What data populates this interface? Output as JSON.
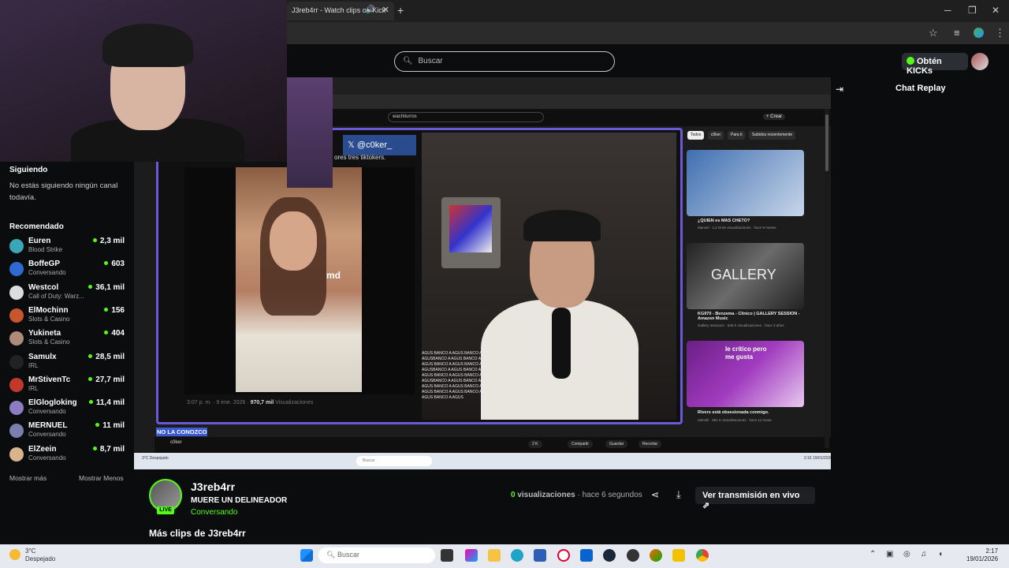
{
  "browser": {
    "tab_title": "J3reb4rr - Watch clips on Kick",
    "tab_close": "✕",
    "new_tab": "+",
    "minimize": "─",
    "restore": "❐",
    "close": "✕"
  },
  "header": {
    "search_placeholder": "Buscar",
    "kicks_label": "Obtén KICKs"
  },
  "sidebar": {
    "following_title": "Siguiendo",
    "following_empty": "No estás siguiendo ningún canal todavía.",
    "recommended_title": "Recomendado",
    "channels": [
      {
        "name": "Euren",
        "category": "Blood Strike",
        "viewers": "2,3 mil",
        "color": "#3aa7b8"
      },
      {
        "name": "BoffeGP",
        "category": "Conversando",
        "viewers": "603",
        "color": "#2e6ad1"
      },
      {
        "name": "Westcol",
        "category": "Call of Duty: Warz...",
        "viewers": "36,1 mil",
        "color": "#dddddd"
      },
      {
        "name": "ElMochinn",
        "category": "Slots & Casino",
        "viewers": "156",
        "color": "#c9552e"
      },
      {
        "name": "Yukineta",
        "category": "Slots & Casino",
        "viewers": "404",
        "color": "#b08a7a"
      },
      {
        "name": "Samulx",
        "category": "IRL",
        "viewers": "28,5 mil",
        "color": "#222222"
      },
      {
        "name": "MrStivenTc",
        "category": "IRL",
        "viewers": "27,7 mil",
        "color": "#c0392b"
      },
      {
        "name": "ElGlogloking",
        "category": "Conversando",
        "viewers": "11,4 mil",
        "color": "#8e7cc3"
      },
      {
        "name": "MERNUEL",
        "category": "Conversando",
        "viewers": "11 mil",
        "color": "#7a7fb0"
      },
      {
        "name": "ElZeein",
        "category": "Conversando",
        "viewers": "8,7 mil",
        "color": "#d9b38c"
      }
    ],
    "show_more": "Mostrar más",
    "show_less": "Mostrar Menos"
  },
  "clip_content": {
    "x_handle": "@c0ker_",
    "tiktokers_text": "ores tres tiktokers.",
    "md_logo": "md",
    "tweet_time": "3:07 p. m. · 9 ene. 2026 ·",
    "tweet_views": "970,7 mil",
    "tweet_views_label": "Visualizaciones",
    "caption": "NO LA CONOZCO",
    "chat_overlay": "AGUS BANCO A AGUS BANCO A AGUSBANCO A AGUS BANCO A AGUS BANCO A AGUS BANCO A AGUSBANCO A AGUS BANCO A AGUS BANCO A AGUS BANCO A AGUSBANCO A AGUS BANCO A AGUS BANCO A AGUS BANCO A AGUS BANCO A AGUS BANCO A AGUS BANCO A AGUS",
    "yt_search": "wachiturros",
    "yt_create": "+ Crear",
    "yt_pills": [
      "Todos",
      "c0ker",
      "Para ti",
      "Subidos recientemente"
    ],
    "yt_videos": [
      {
        "title": "¿QUIEN es MAS CHETO?",
        "meta": "Mansel · 1,2 M de visualizaciones · hace 9 meses",
        "color": "#3f6fb0"
      },
      {
        "title": "KG970 - Benzema - Clínico | GALLERY SESSION - Amazon Music",
        "meta": "Gallery Sessions · 645 K visualizaciones · hace 3 años",
        "color": "#6b6b6b"
      },
      {
        "title": "Rivers está obsesionada conmigo.",
        "meta": "rubcelli · 591 K visualizaciones · hace 11 horas",
        "color": "#a13bbf"
      }
    ],
    "gallery_text": "GALLERY",
    "critico_text": "le crítico pero me gusta",
    "yt_channel": "c0ker",
    "yt_like": "2 K",
    "yt_share": "Compartir",
    "yt_save": "Guardar",
    "yt_clip": "Recortar",
    "inner_search": "Buscar",
    "inner_weather": "3°C Despejado",
    "inner_clock": "2:16 19/01/2026"
  },
  "stream": {
    "streamer": "J3reb4rr",
    "title": "MUERE UN DELINEADOR",
    "category": "Conversando",
    "live_badge": "LIVE",
    "views_count": "0",
    "views_label": "visualizaciones",
    "time_ago": "· hace 6 segundos",
    "watch_live": "Ver transmisión en vivo ⇗",
    "more_clips": "Más clips de J3reb4rr"
  },
  "chat": {
    "title": "Chat Replay"
  },
  "taskbar": {
    "weather_temp": "3°C",
    "weather_desc": "Despejado",
    "search_placeholder": "Buscar",
    "time": "2:17",
    "date": "19/01/2026"
  },
  "colors": {
    "accent_green": "#53fc18",
    "background": "#0b0c0d"
  }
}
